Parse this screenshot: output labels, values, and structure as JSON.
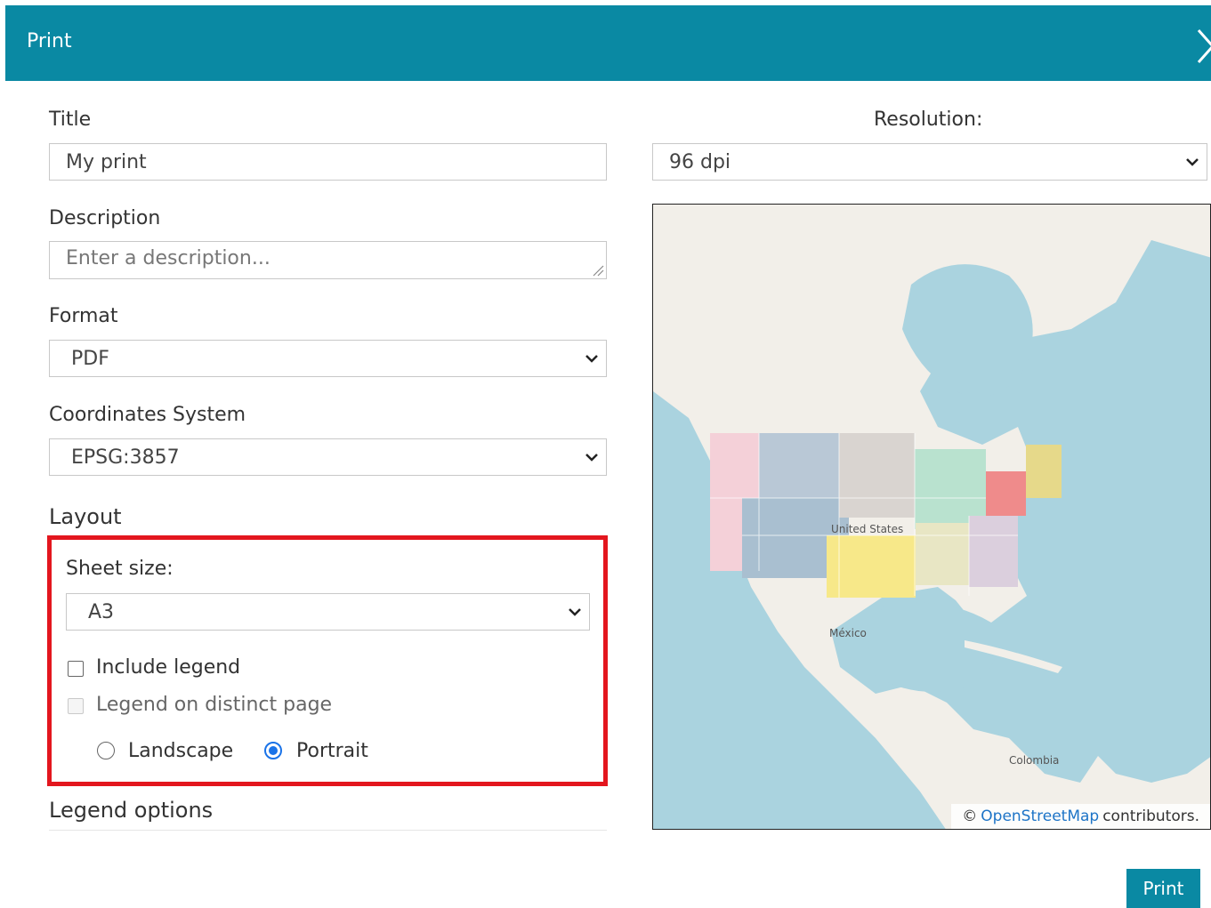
{
  "dialog": {
    "title": "Print",
    "colors": {
      "header": "#0a89a3",
      "highlight": "#e3161e",
      "radio": "#1a73e8"
    }
  },
  "form": {
    "title_label": "Title",
    "title_value": "My print",
    "description_label": "Description",
    "description_placeholder": "Enter a description...",
    "format_label": "Format",
    "format_value": "PDF",
    "crs_label": "Coordinates System",
    "crs_value": "EPSG:3857",
    "resolution_label": "Resolution:",
    "resolution_value": "96 dpi"
  },
  "layout": {
    "section_title": "Layout",
    "sheet_size_label": "Sheet size:",
    "sheet_size_value": "A3",
    "include_legend_label": "Include legend",
    "include_legend_checked": false,
    "legend_distinct_label": "Legend on distinct page",
    "legend_distinct_checked": false,
    "legend_distinct_disabled": true,
    "orientation": {
      "landscape_label": "Landscape",
      "portrait_label": "Portrait",
      "selected": "Portrait"
    }
  },
  "legend_options": {
    "section_title": "Legend options"
  },
  "map": {
    "labels": {
      "us": "United States",
      "mexico": "México",
      "colombia": "Colombia"
    },
    "attribution_prefix": "©",
    "attribution_link": "OpenStreetMap",
    "attribution_suffix": "contributors."
  },
  "footer": {
    "print_label": "Print"
  }
}
